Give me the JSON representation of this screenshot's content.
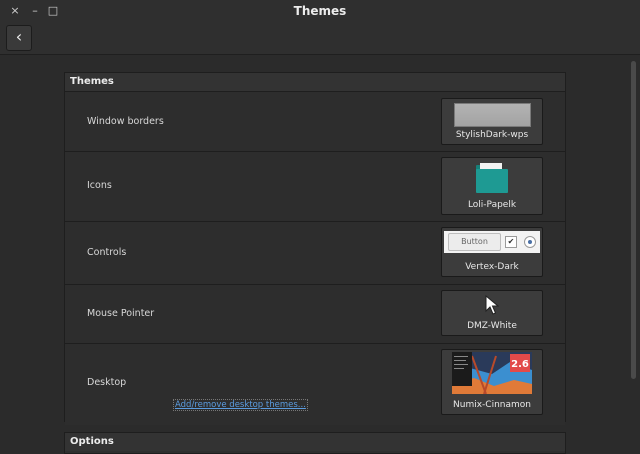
{
  "window": {
    "title": "Themes",
    "close_glyph": "×",
    "minimize_glyph": "–",
    "maximize_glyph": "□"
  },
  "toolbar": {
    "back_glyph": "‹"
  },
  "themes": {
    "header": "Themes",
    "rows": [
      {
        "label": "Window borders",
        "value": "StylishDark-wps",
        "icon": "window-border-preview-icon"
      },
      {
        "label": "Icons",
        "value": "Loli-Papelk",
        "icon": "folder-icon"
      },
      {
        "label": "Controls",
        "value": "Vertex-Dark",
        "icon": "controls-preview-icon",
        "preview_button": "Button",
        "preview_check": "✔"
      },
      {
        "label": "Mouse Pointer",
        "value": "DMZ-White",
        "icon": "cursor-arrow-icon"
      },
      {
        "label": "Desktop",
        "value": "Numix-Cinnamon",
        "icon": "desktop-preview-icon",
        "preview_version": "2.6"
      }
    ],
    "desktop_link": "Add/remove desktop themes..."
  },
  "options": {
    "header": "Options"
  },
  "colors": {
    "link": "#5b9ce0",
    "folder": "#1e9a93",
    "desktop_badge": "#e24a4a"
  }
}
